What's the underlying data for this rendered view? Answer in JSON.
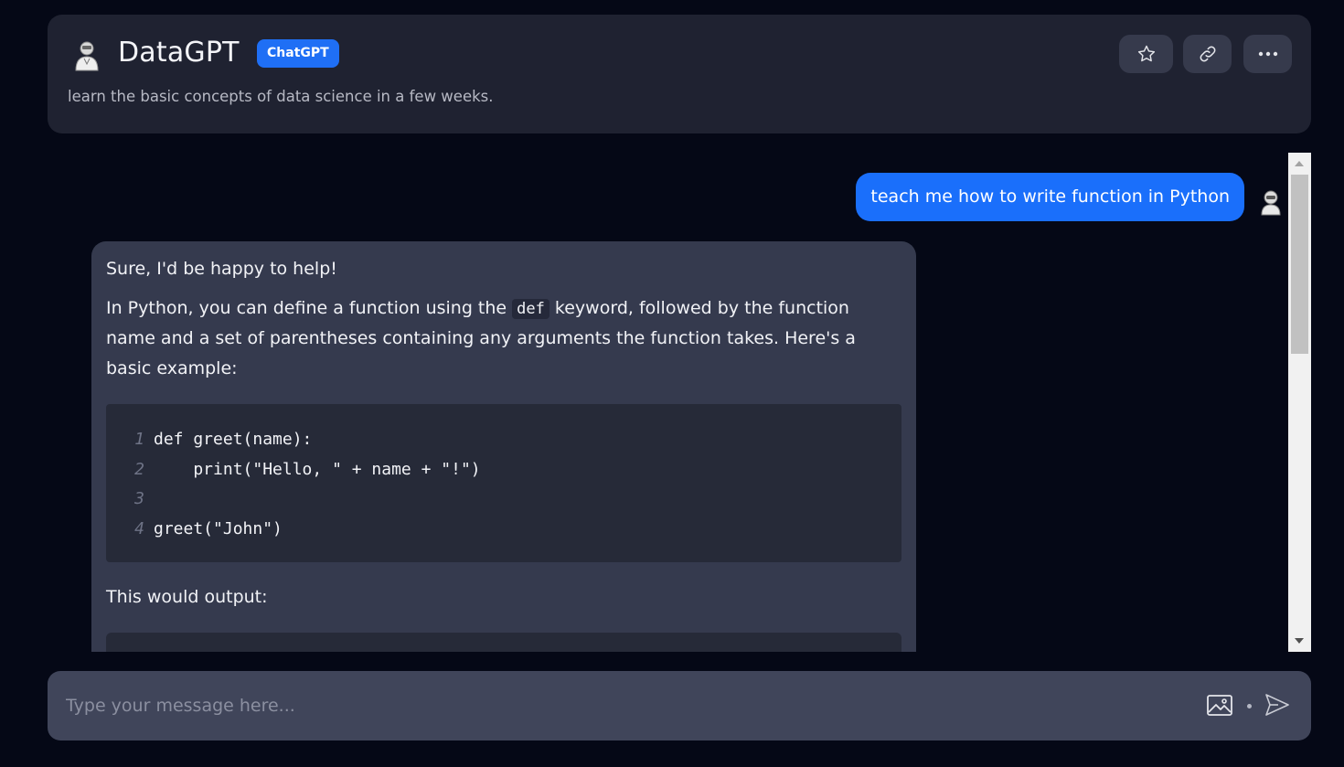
{
  "header": {
    "title": "DataGPT",
    "badge": "ChatGPT",
    "subtitle": "learn the basic concepts of data science in a few weeks.",
    "actions": [
      "star-icon",
      "link-icon",
      "more-icon"
    ]
  },
  "chat": {
    "user_message": "teach me how to write function in Python",
    "bot": {
      "p1": "Sure, I'd be happy to help!",
      "p2_before": "In Python, you can define a function using the ",
      "p2_code": "def",
      "p2_after": " keyword, followed by the function name and a set of parentheses containing any arguments the function takes. Here's a basic example:",
      "code_lines": [
        {
          "n": "1",
          "text": "def greet(name):"
        },
        {
          "n": "2",
          "text": "    print(\"Hello, \" + name + \"!\")"
        },
        {
          "n": "3",
          "text": ""
        },
        {
          "n": "4",
          "text": "greet(\"John\")"
        }
      ],
      "p3": "This would output:"
    }
  },
  "composer": {
    "placeholder": "Type your message here...",
    "icons": [
      "image-icon",
      "send-icon"
    ]
  },
  "colors": {
    "background": "#050816",
    "card": "#1f2231",
    "accent": "#1a6ffb",
    "bot_bubble": "#353a4e",
    "code_bg": "#262a38"
  }
}
